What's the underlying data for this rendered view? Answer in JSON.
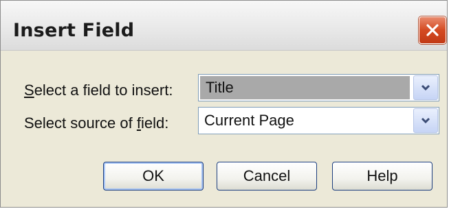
{
  "dialog": {
    "title": "Insert Field",
    "close_icon": "close-icon"
  },
  "fields": {
    "field_label_prefix": "S",
    "field_label_rest": "elect a field to insert:",
    "field_value": "Title",
    "source_label_prefix": "Select source of ",
    "source_label_accel": "f",
    "source_label_rest": "ield:",
    "source_value": "Current Page",
    "dropdown_icon": "chevron-down-icon"
  },
  "buttons": {
    "ok": "OK",
    "cancel": "Cancel",
    "help": "Help"
  },
  "colors": {
    "close_button": "#d44a22",
    "selection": "#a9a9a9",
    "dialog_bg": "#ece9d8"
  }
}
